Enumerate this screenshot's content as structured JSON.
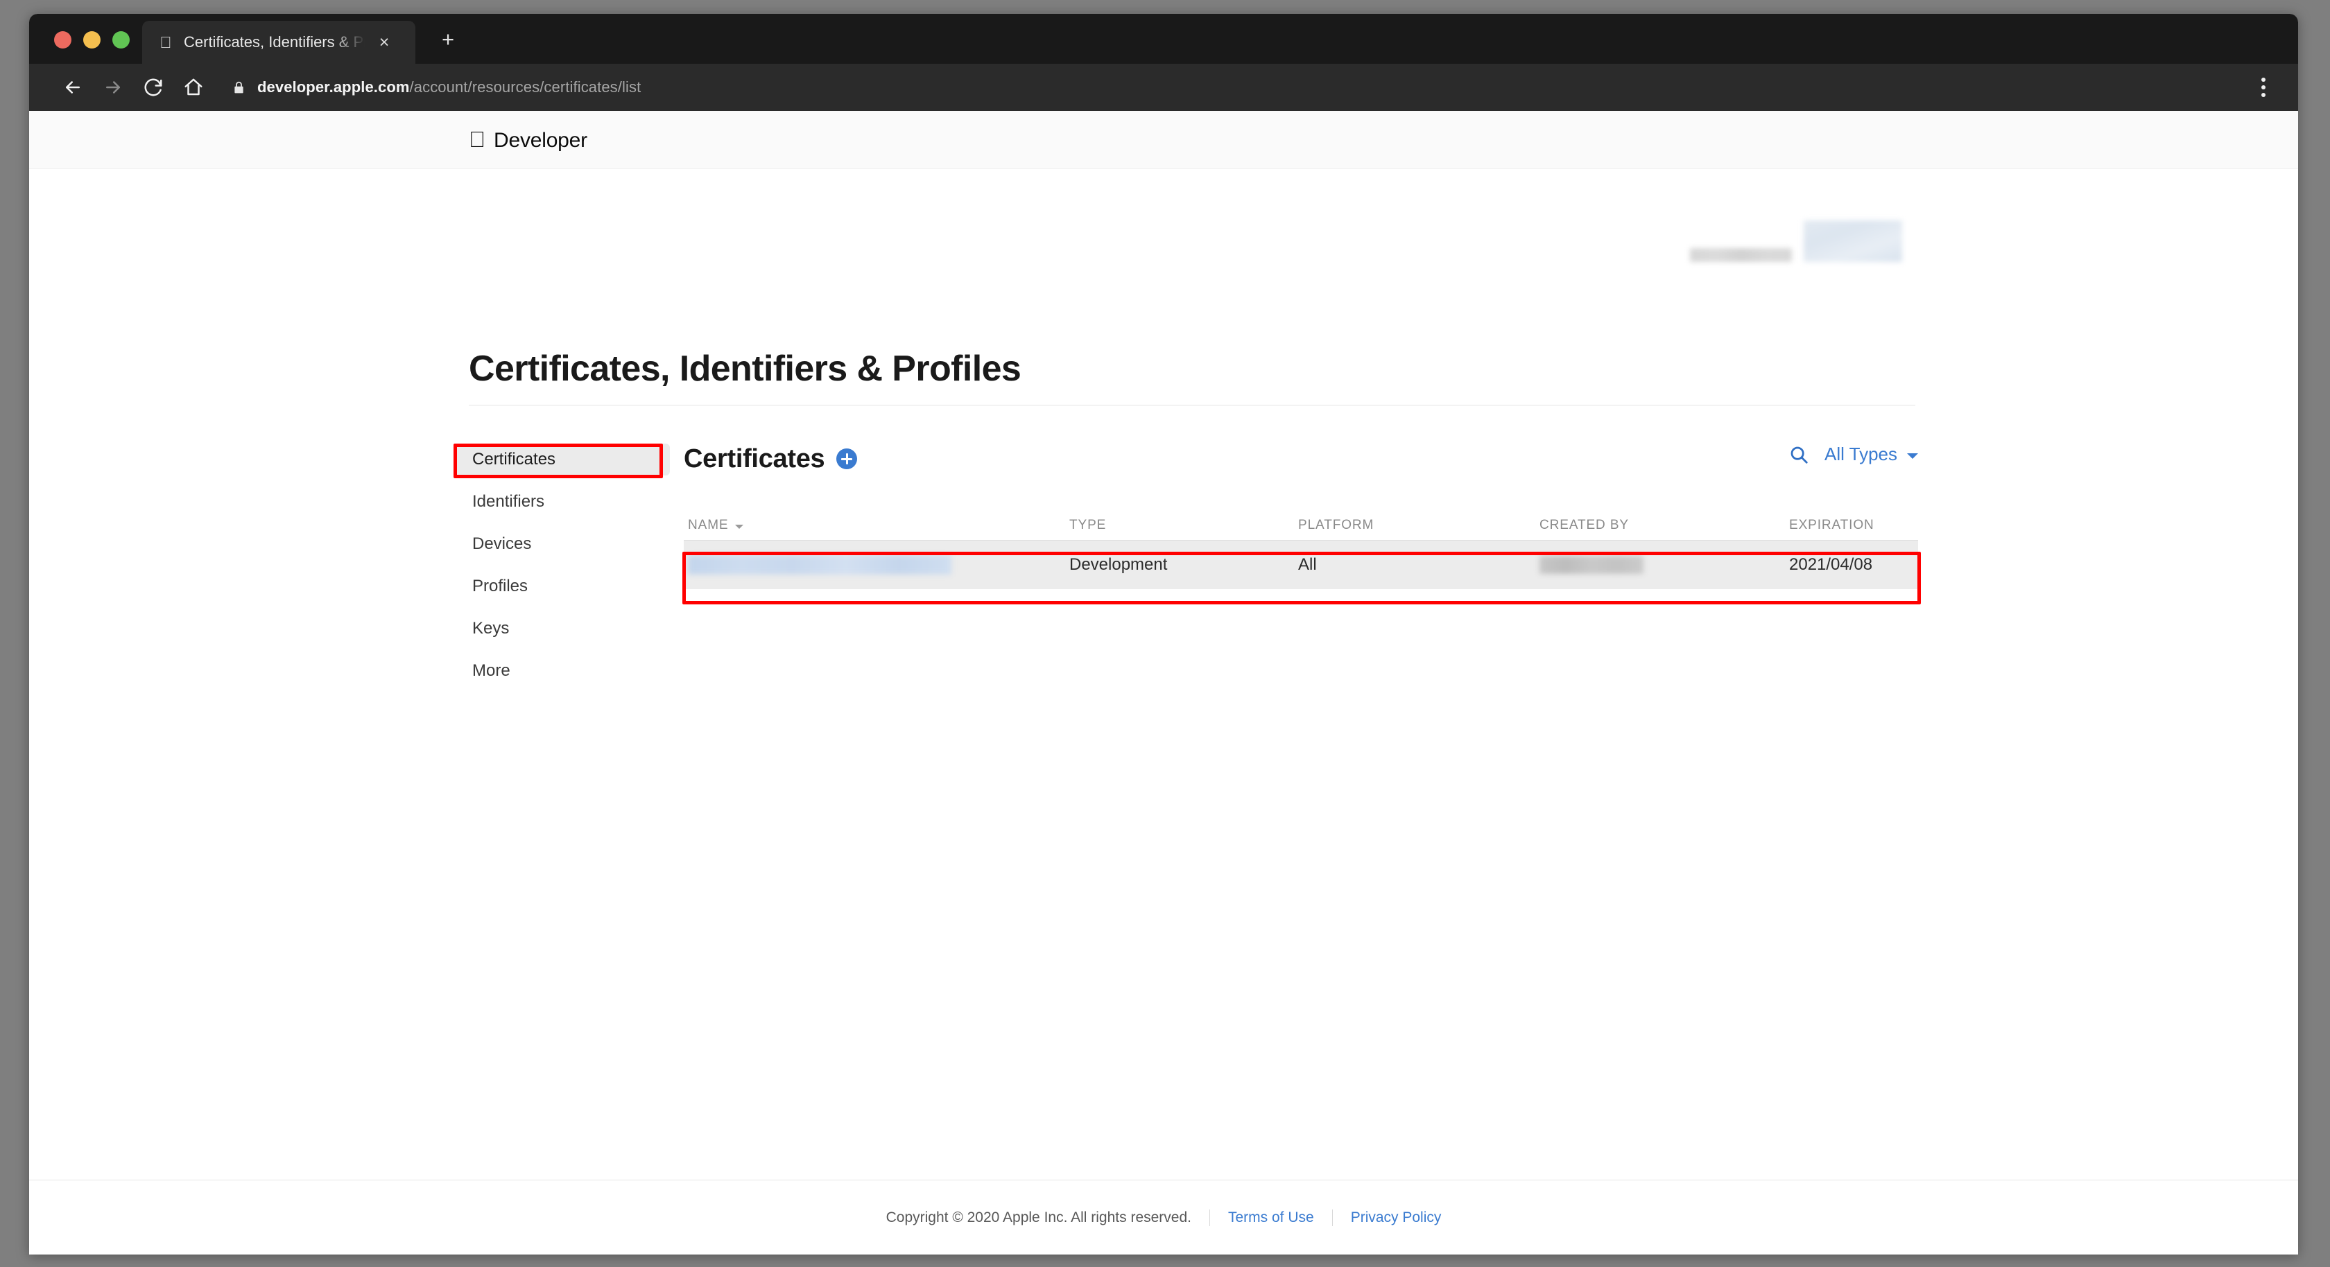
{
  "browser": {
    "tab": {
      "favicon": "apple-icon",
      "title": "Certificates, Identifiers & Profiles",
      "close_label": "×"
    },
    "new_tab_label": "+",
    "nav": {
      "back": "back-arrow-icon",
      "forward": "forward-arrow-icon",
      "reload": "reload-icon",
      "home": "home-icon"
    },
    "omnibox": {
      "lock": "lock-icon",
      "host": "developer.apple.com",
      "path": "/account/resources/certificates/list"
    },
    "menu_label": "kebab-menu-icon"
  },
  "site_header": {
    "apple_logo": "",
    "brand": "Developer"
  },
  "page": {
    "title": "Certificates, Identifiers & Profiles"
  },
  "sidebar": {
    "items": [
      {
        "label": "Certificates",
        "active": true
      },
      {
        "label": "Identifiers",
        "active": false
      },
      {
        "label": "Devices",
        "active": false
      },
      {
        "label": "Profiles",
        "active": false
      },
      {
        "label": "Keys",
        "active": false
      },
      {
        "label": "More",
        "active": false
      }
    ]
  },
  "panel": {
    "title": "Certificates",
    "add_button_label": "+",
    "search_icon": "search-icon",
    "filter_label": "All Types",
    "filter_chevron": "chevron-down-icon"
  },
  "table": {
    "columns": [
      "NAME",
      "TYPE",
      "PLATFORM",
      "CREATED BY",
      "EXPIRATION"
    ],
    "sort_column": "NAME",
    "sort_chevron": "chevron-down-icon",
    "rows": [
      {
        "name": "",
        "name_redacted": true,
        "type": "Development",
        "platform": "All",
        "created_by": "",
        "created_by_redacted": true,
        "expiration": "2021/04/08",
        "highlighted": true
      }
    ]
  },
  "footer": {
    "copyright": "Copyright © 2020 Apple Inc. All rights reserved.",
    "links": [
      "Terms of Use",
      "Privacy Policy"
    ]
  },
  "annotations": {
    "highlight_color": "#ff0000",
    "accent_color": "#3a7bd0"
  }
}
